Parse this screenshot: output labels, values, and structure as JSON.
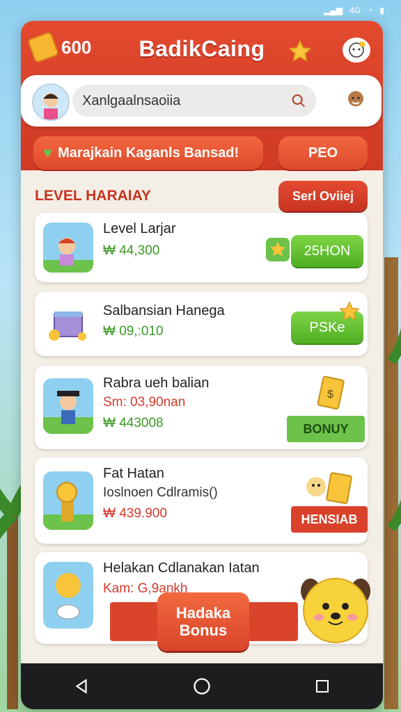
{
  "status": {
    "signal": "4G",
    "battery": "▮"
  },
  "header": {
    "coins": "600",
    "title": "BadikCaing"
  },
  "search": {
    "placeholder": "Xanlgaalnsaoiia"
  },
  "promo": {
    "message": "Marajkain Kaganls Bansad!",
    "action": "PEO"
  },
  "section": {
    "title": "LEVEL HARAIAY",
    "action": "Serl Oviiej"
  },
  "cards": [
    {
      "title": "Level Larjar",
      "sub": "₩ 44,300",
      "action": "25HON"
    },
    {
      "title": "Salbansian Hanega",
      "sub": "₩ 09,:010",
      "action": "PSKe"
    },
    {
      "title": "Rabra ueh balian",
      "sub": "Sm: 03,90nan",
      "sub2": "₩ 443008",
      "badge": "BONUY"
    },
    {
      "title": "Fat Hatan",
      "sub": "Ioslnoen Cdlramis()",
      "sub2": "₩ 439.900",
      "badge": "HENSIAB"
    },
    {
      "title": "Helakan Cdlanakan Iatan",
      "sub": "Kam: G,9ankh"
    }
  ],
  "bonus": {
    "line1": "Hadaka",
    "line2": "Bonus"
  },
  "nav": {
    "back": "back",
    "home": "home",
    "recent": "recent"
  },
  "colors": {
    "header": "#d9412a",
    "green": "#4fae22",
    "accent": "#f7b731"
  }
}
